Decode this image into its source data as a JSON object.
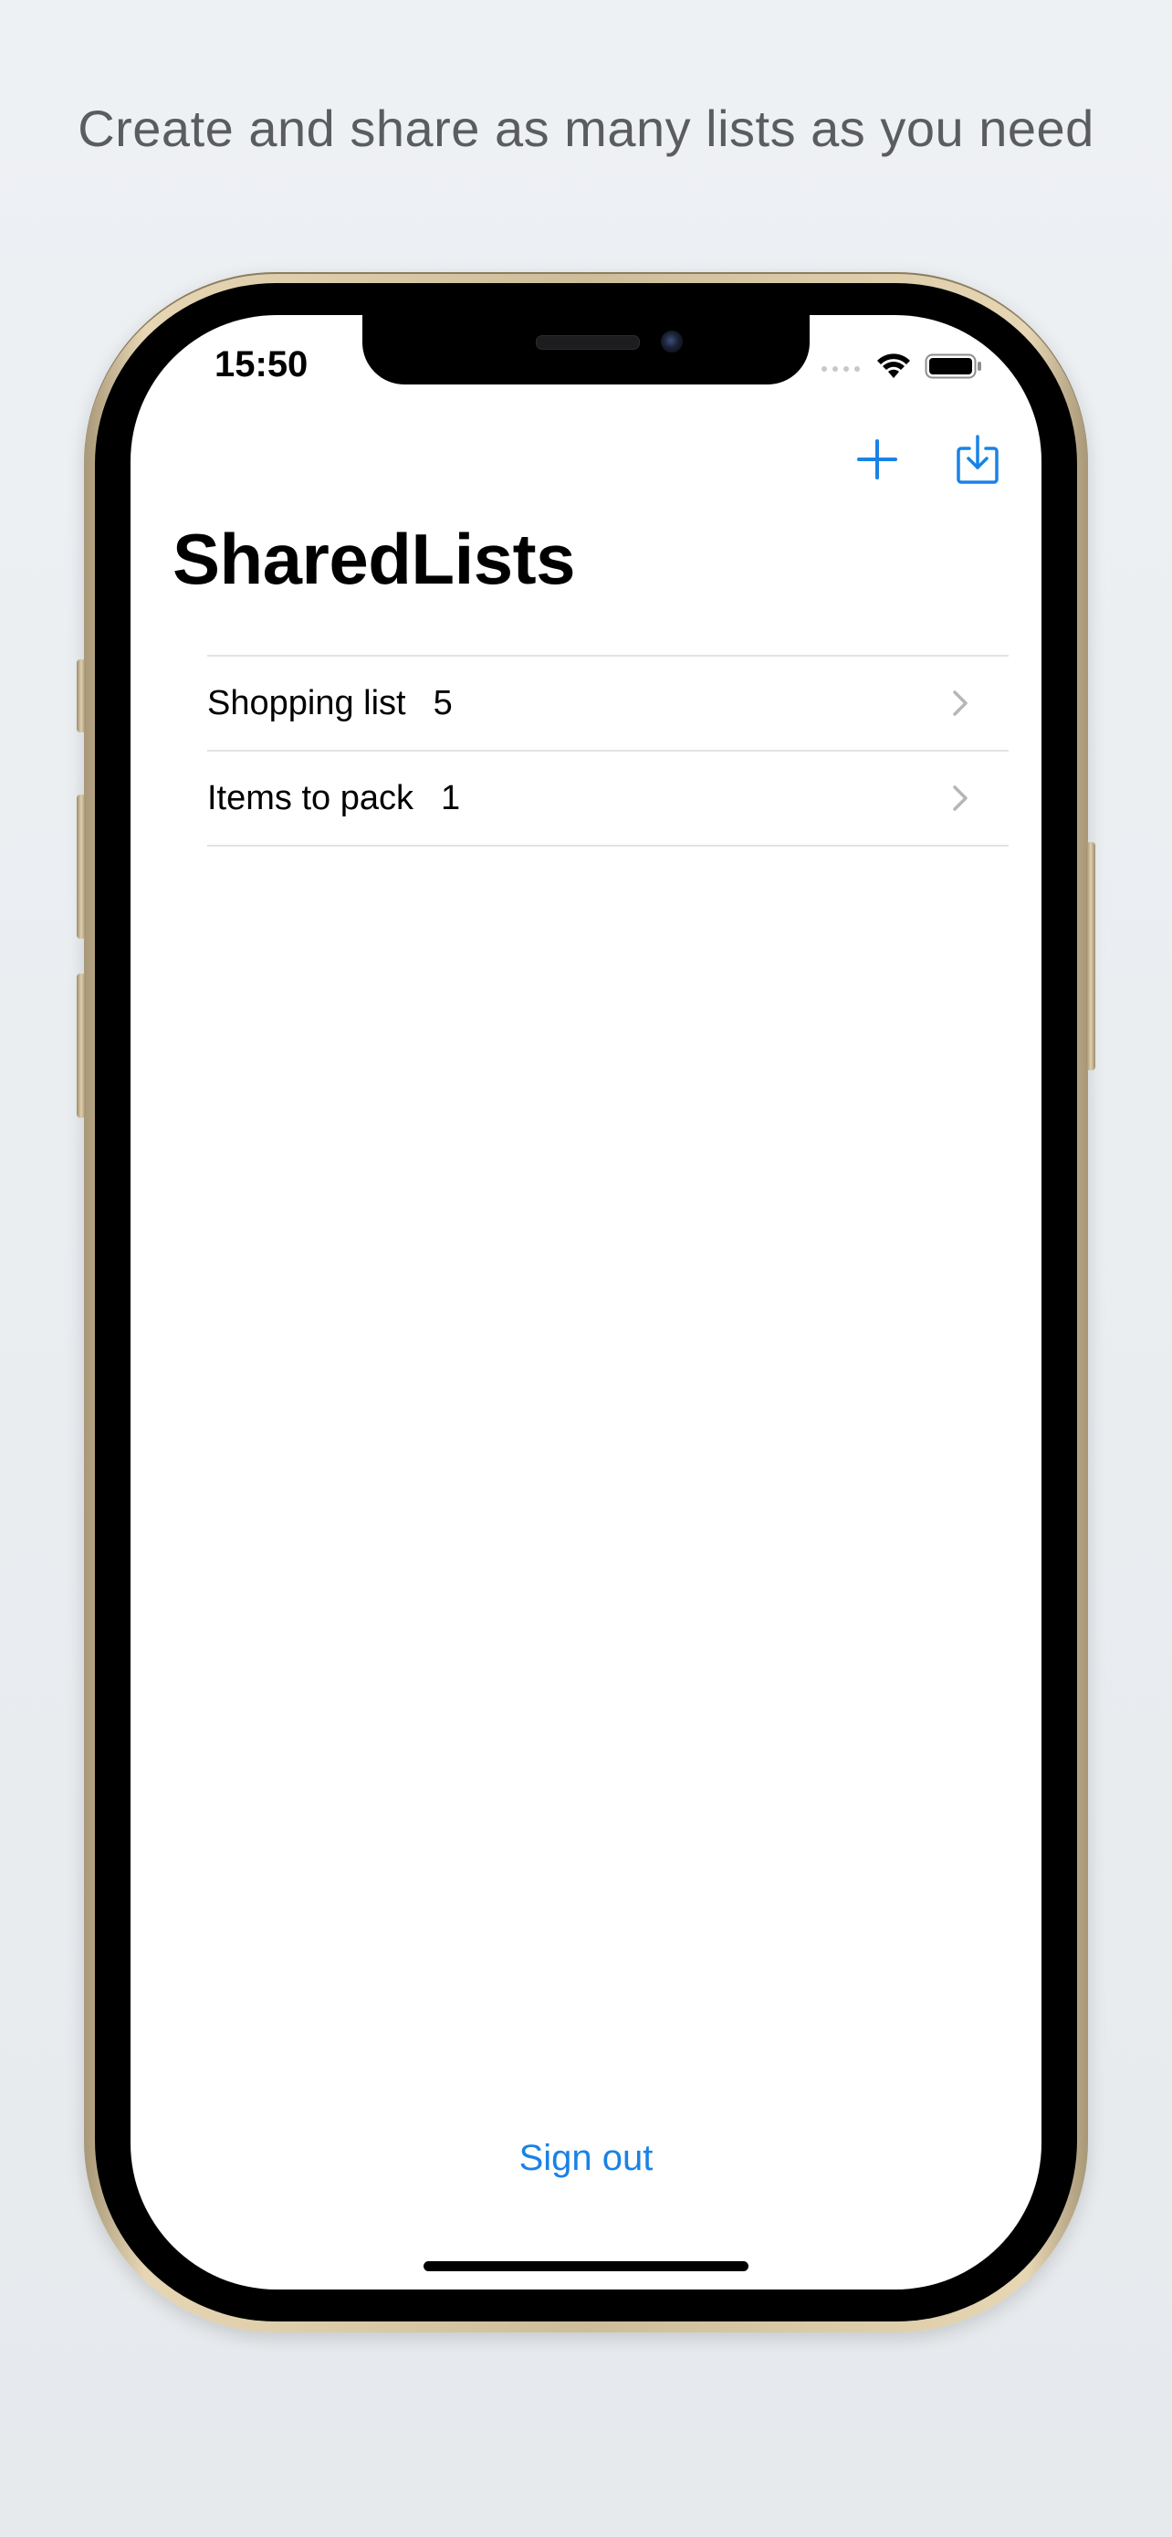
{
  "headline": "Create and share as many lists as you need",
  "status_bar": {
    "time": "15:50"
  },
  "nav": {
    "title": "SharedLists",
    "add_icon": "plus-icon",
    "import_icon": "tray-arrow-down-icon"
  },
  "lists": [
    {
      "name": "Shopping list",
      "count": "5"
    },
    {
      "name": "Items to pack",
      "count": "1"
    }
  ],
  "footer": {
    "sign_out_label": "Sign out"
  },
  "colors": {
    "accent": "#1a82e6",
    "background": "#eef1f4",
    "separator": "#e2e2e4"
  }
}
